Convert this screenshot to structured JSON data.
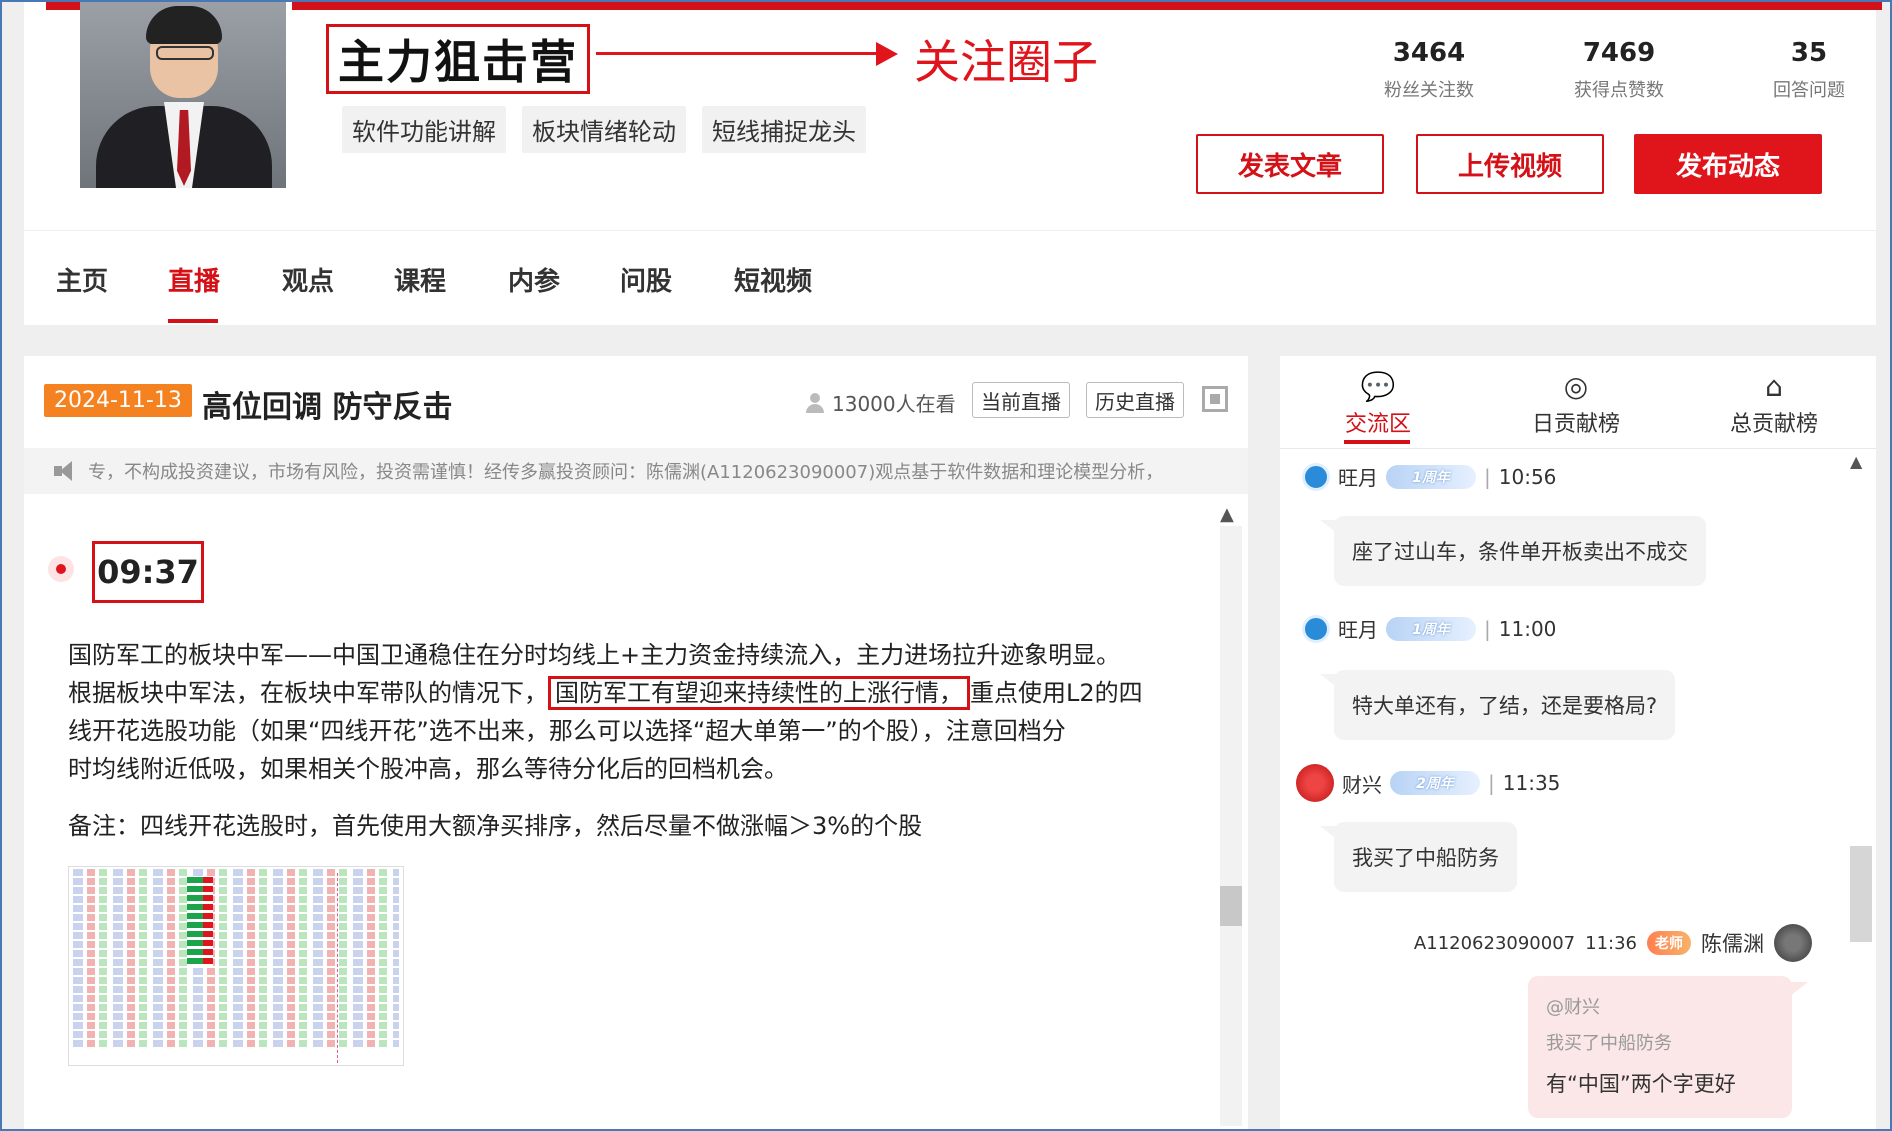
{
  "header": {
    "channel_title": "主力狙击营",
    "annotation_follow": "关注圈子",
    "tags": [
      "软件功能讲解",
      "板块情绪轮动",
      "短线捕捉龙头"
    ],
    "stats": [
      {
        "value": "3464",
        "label": "粉丝关注数"
      },
      {
        "value": "7469",
        "label": "获得点赞数"
      },
      {
        "value": "35",
        "label": "回答问题"
      }
    ],
    "buttons": {
      "publish_article": "发表文章",
      "upload_video": "上传视频",
      "publish_dynamic": "发布动态"
    },
    "accent_color": "#d31117"
  },
  "nav": {
    "items": [
      "主页",
      "直播",
      "观点",
      "课程",
      "内参",
      "问股",
      "短视频"
    ],
    "active": "直播"
  },
  "live": {
    "date": "2024-11-13",
    "title": "高位回调 防守反击",
    "viewers": "13000人在看",
    "current_live": "当前直播",
    "history_live": "历史直播",
    "notice": "专，不构成投资建议，市场有风险，投资需谨慎！经传多赢投资顾问：陈儒渊(A1120623090007)观点基于软件数据和理论模型分析，",
    "post_time": "09:37",
    "post_lines": {
      "l1": "国防军工的板块中军——中国卫通稳住在分时均线上+主力资金持续流入，主力进场拉升迹象明显。",
      "l2_a": "根据板块中军法，在板块中军带队的情况下，",
      "l2_hl": "国防军工有望迎来持续性的上涨行情，",
      "l2_b": "重点使用L2的四",
      "l3": "线开花选股功能（如果“四线开花”选不出来，那么可以选择“超大单第一”的个股），注意回档分",
      "l4": "时均线附近低吸，如果相关个股冲高，那么等待分化后的回档机会。"
    },
    "remark": "备注：四线开花选股时，首先使用大额净买排序，然后尽量不做涨幅＞3%的个股"
  },
  "chat": {
    "tabs": [
      "交流区",
      "日贡献榜",
      "总贡献榜"
    ],
    "active_tab": "交流区",
    "messages": [
      {
        "user": "旺月",
        "level": "1周年",
        "time": "10:56",
        "text": "座了过山车，条件单开板卖出不成交"
      },
      {
        "user": "旺月",
        "level": "1周年",
        "time": "11:00",
        "text": "特大单还有，了结，还是要格局?"
      },
      {
        "user": "财兴",
        "level": "2周年",
        "time": "11:35",
        "text": "我买了中船防务"
      }
    ],
    "teacher_reply": {
      "code": "A1120623090007",
      "time": "11:36",
      "badge": "老师",
      "name": "陈儒渊",
      "quote_user": "@财兴",
      "quote_text": "我买了中船防务",
      "text": "有“中国”两个字更好"
    }
  }
}
